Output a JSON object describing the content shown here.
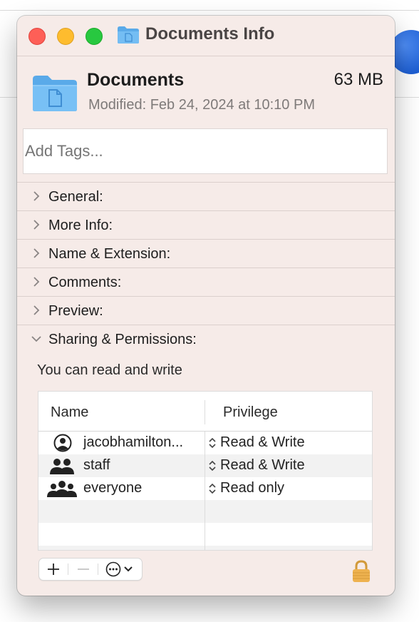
{
  "window": {
    "title": "Documents Info"
  },
  "file": {
    "name": "Documents",
    "size": "63 MB",
    "modified": "Modified: Feb 24, 2024 at 10:10 PM"
  },
  "tags": {
    "placeholder": "Add Tags..."
  },
  "sections": {
    "general": "General:",
    "more_info": "More Info:",
    "name_extension": "Name & Extension:",
    "comments": "Comments:",
    "preview": "Preview:",
    "sharing": "Sharing & Permissions:"
  },
  "permissions": {
    "summary": "You can read and write",
    "columns": {
      "name": "Name",
      "privilege": "Privilege"
    },
    "rows": [
      {
        "name": "jacobhamilton...",
        "privilege": "Read & Write",
        "icon": "user-icon"
      },
      {
        "name": "staff",
        "privilege": "Read & Write",
        "icon": "group-icon"
      },
      {
        "name": "everyone",
        "privilege": "Read only",
        "icon": "everyone-icon"
      }
    ]
  },
  "colors": {
    "window_bg": "#f6ebe8",
    "folder_blue": "#6cb6f0",
    "close": "#fe5f57",
    "minimize": "#febc2e",
    "zoom": "#28c840",
    "lock": "#e0a63e"
  }
}
